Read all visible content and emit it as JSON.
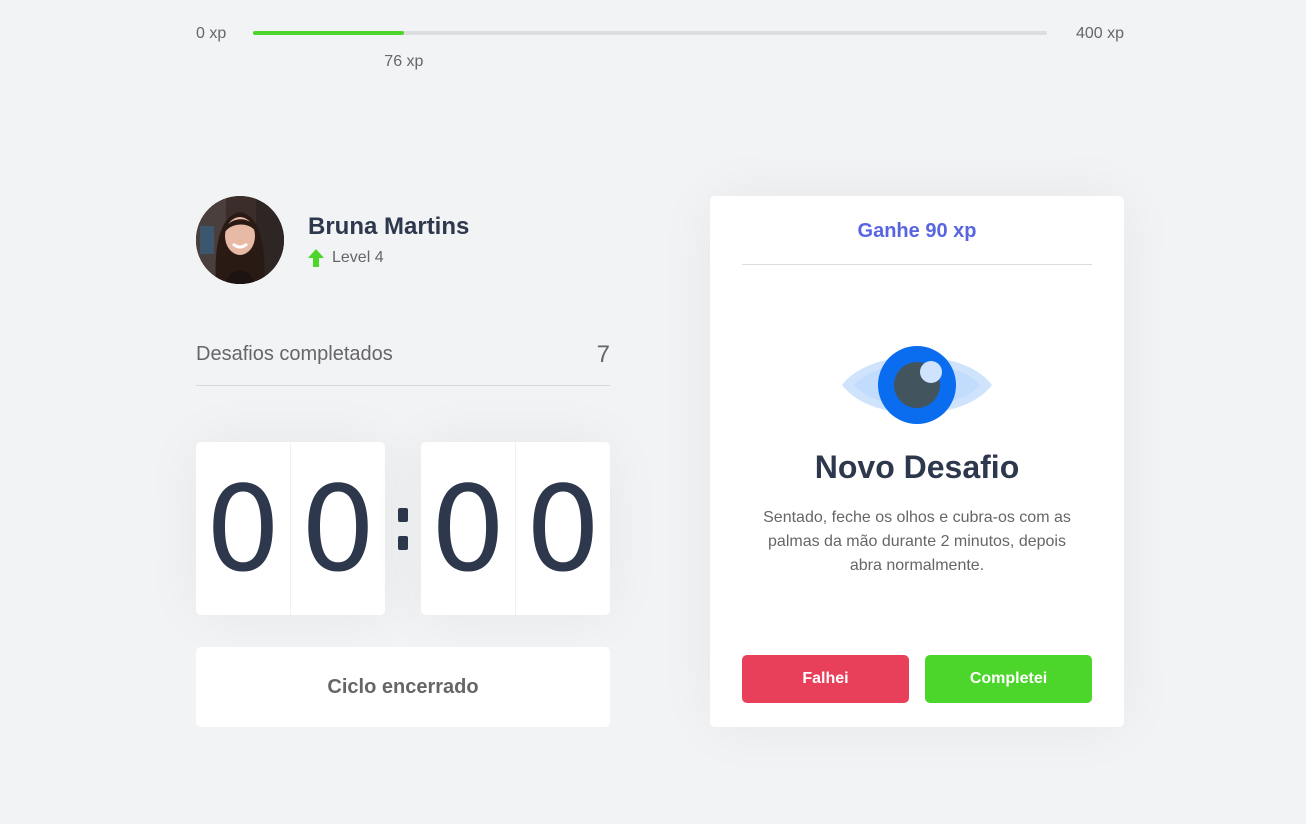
{
  "xp": {
    "min_label": "0 xp",
    "max_label": "400 xp",
    "current_label": "76 xp",
    "current": 76,
    "max": 400,
    "progress_color": "#4cd62b"
  },
  "profile": {
    "name": "Bruna Martins",
    "level_label": "Level 4",
    "level_icon": "level-up-arrow-icon"
  },
  "stats": {
    "completed_label": "Desafios completados",
    "completed_count": "7"
  },
  "countdown": {
    "minutes": [
      "0",
      "0"
    ],
    "seconds": [
      "0",
      "0"
    ],
    "cycle_button_label": "Ciclo encerrado"
  },
  "challenge": {
    "reward_label": "Ganhe 90 xp",
    "icon": "eye-icon",
    "title": "Novo Desafio",
    "description": "Sentado, feche os olhos e cubra-os com as palmas da mão durante 2 minutos, depois abra normalmente.",
    "fail_label": "Falhei",
    "success_label": "Completei"
  },
  "colors": {
    "background": "#f2f3f5",
    "title": "#2e384d",
    "accent": "#5965e0",
    "fail": "#e83f5b",
    "success": "#4cd62b"
  }
}
